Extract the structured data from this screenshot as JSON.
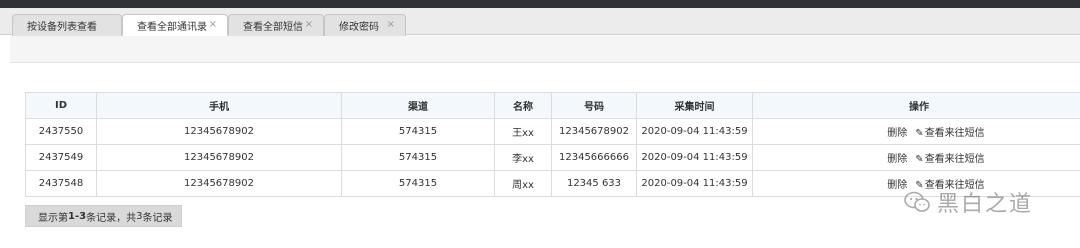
{
  "tabs": [
    {
      "label": "按设备列表查看",
      "closable": false,
      "active": false
    },
    {
      "label": "查看全部通讯录",
      "closable": true,
      "active": true
    },
    {
      "label": "查看全部短信",
      "closable": true,
      "active": false
    },
    {
      "label": "修改密码",
      "closable": true,
      "active": false
    }
  ],
  "tab_close_glyph": "×",
  "table": {
    "headers": [
      "ID",
      "手机",
      "渠道",
      "名称",
      "号码",
      "采集时间",
      "操作"
    ],
    "rows": [
      {
        "id": "2437550",
        "phone": "12345678902",
        "channel": "574315",
        "name": "王xx",
        "number": "12345678902",
        "time": "2020-09-04 11:43:59",
        "delete_label": "删除",
        "view_sms_label": "查看来往短信"
      },
      {
        "id": "2437549",
        "phone": "12345678902",
        "channel": "574315",
        "name": "李xx",
        "number": "12345666666",
        "time": "2020-09-04 11:43:59",
        "delete_label": "删除",
        "view_sms_label": "查看来往短信"
      },
      {
        "id": "2437548",
        "phone": "12345678902",
        "channel": "574315",
        "name": "周xx",
        "number": "12345 633",
        "time": "2020-09-04 11:43:59",
        "delete_label": "删除",
        "view_sms_label": "查看来往短信"
      }
    ]
  },
  "pager": {
    "prefix": "显示第 ",
    "range": "1-3",
    "middle": " 条记录，共 ",
    "total": "3",
    "suffix": " 条记录"
  },
  "watermark": {
    "text": "黑白之道",
    "icon": "wechat-icon"
  },
  "colors": {
    "topbar": "#2f3237",
    "header_bg": "#f3f8fc",
    "pager_bg": "#d9d9d9"
  }
}
